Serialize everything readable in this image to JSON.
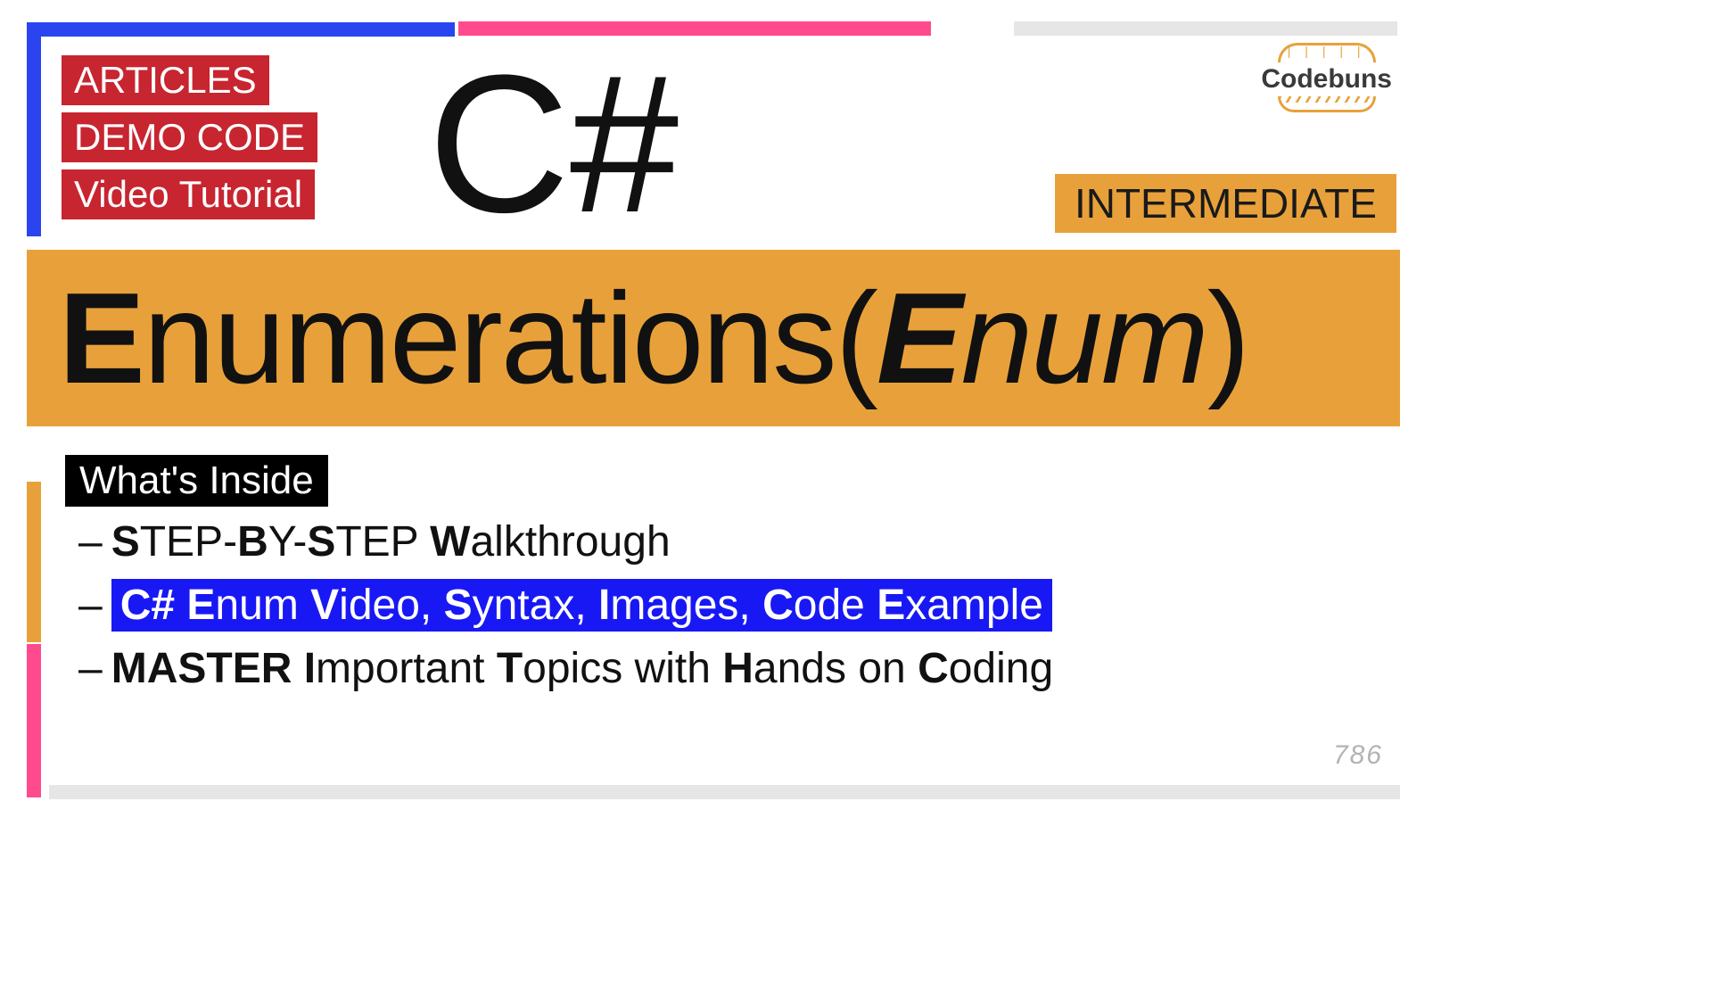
{
  "tags": {
    "t1": "ARTICLES",
    "t2": "DEMO CODE",
    "t3": "Video Tutorial"
  },
  "csharp": "C#",
  "logo": {
    "brand": "Codebuns"
  },
  "level": "INTERMEDIATE",
  "title": {
    "e1": "E",
    "num": "numerations ",
    "po": "(",
    "e2": "E",
    "numi": "num",
    "pc": ")"
  },
  "whatsInside": "What's Inside",
  "bullet1": {
    "dash": "–",
    "p1": "S",
    "p2": "TEP-",
    "p3": "B",
    "p4": "Y-",
    "p5": "S",
    "p6": "TEP ",
    "p7": "W",
    "p8": "alkthrough"
  },
  "bullet2": {
    "dash": "–",
    "p1": "C# E",
    "p2": "num ",
    "p3": "V",
    "p4": "ideo, ",
    "p5": "S",
    "p6": "yntax, ",
    "p7": "I",
    "p8": "mages, ",
    "p9": "C",
    "p10": "ode ",
    "p11": "E",
    "p12": "xample"
  },
  "bullet3": {
    "dash": "–",
    "p1": "MASTER I",
    "p2": "mportant ",
    "p3": "T",
    "p4": "opics with ",
    "p5": "H",
    "p6": "ands on ",
    "p7": "C",
    "p8": "oding"
  },
  "pagenum": "786"
}
